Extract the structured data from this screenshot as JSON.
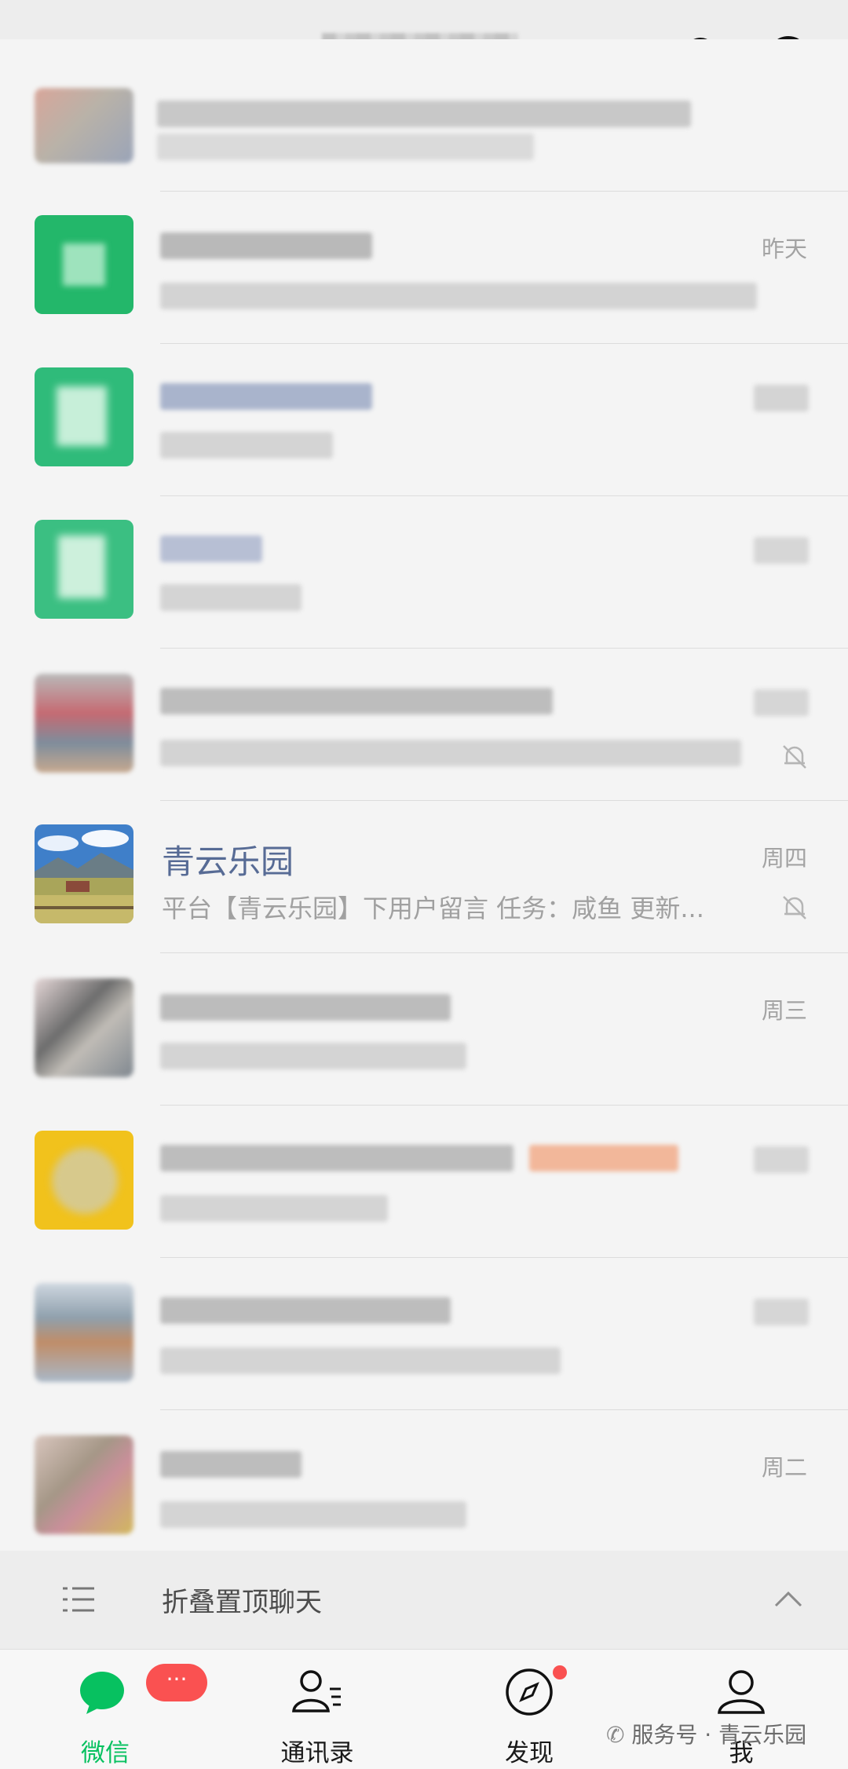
{
  "chats": [
    {
      "name": "",
      "preview": "",
      "time": "",
      "muted": false
    },
    {
      "name": "",
      "preview": "",
      "time": "昨天",
      "muted": false
    },
    {
      "name": "",
      "preview": "",
      "time": "",
      "muted": false
    },
    {
      "name": "",
      "preview": "",
      "time": "",
      "muted": false
    },
    {
      "name": "",
      "preview": "",
      "time": "",
      "muted": true
    },
    {
      "name": "青云乐园",
      "preview": "平台【青云乐园】下用户留言 任务：咸鱼 更新...",
      "time": "周四",
      "muted": true
    },
    {
      "name": "",
      "preview": "",
      "time": "周三",
      "muted": false
    },
    {
      "name": "",
      "preview": "",
      "time": "",
      "muted": false
    },
    {
      "name": "",
      "preview": "",
      "time": "",
      "muted": false
    },
    {
      "name": "",
      "preview": "",
      "time": "周二",
      "muted": false
    }
  ],
  "fold": {
    "label": "折叠置顶聊天"
  },
  "tabs": {
    "chats": {
      "label": "微信",
      "badge": "···"
    },
    "contacts": {
      "label": "通讯录"
    },
    "discover": {
      "label": "发现"
    },
    "me": {
      "label": "我"
    }
  },
  "watermark": {
    "text": "服务号 · 青云乐园"
  },
  "colors": {
    "accent": "#07c160",
    "name_link": "#576b95",
    "badge": "#fa5151"
  }
}
